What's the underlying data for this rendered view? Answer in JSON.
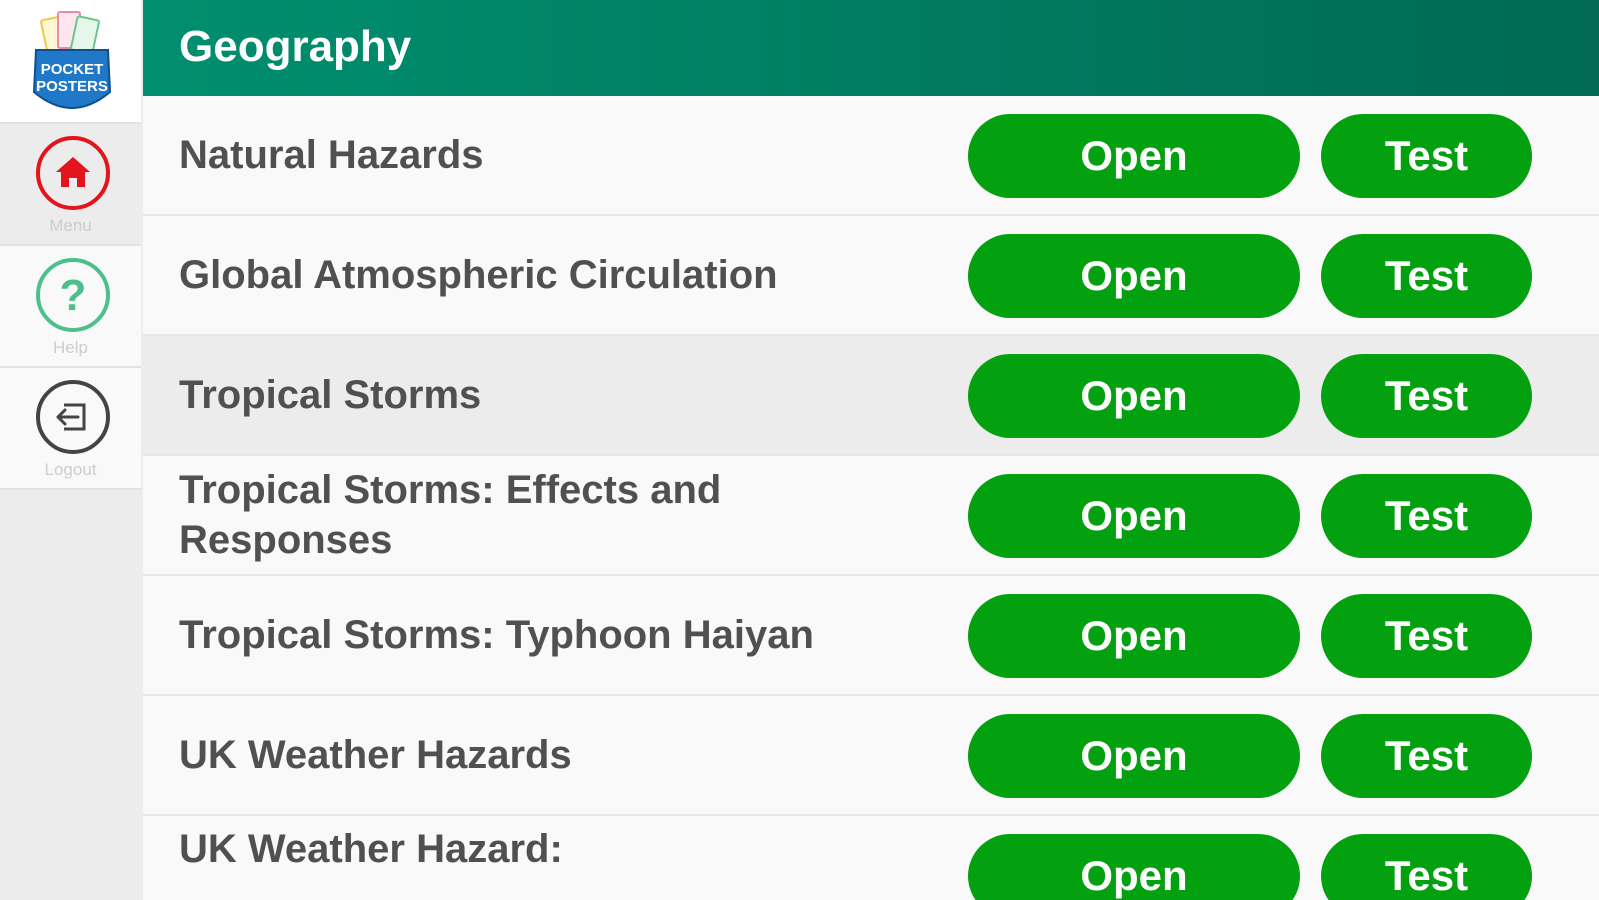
{
  "sidebar": {
    "logo_text": [
      "POCKET",
      "POSTERS"
    ],
    "items": [
      {
        "label": "Menu",
        "icon": "home-icon",
        "color": "#e3141b"
      },
      {
        "label": "Help",
        "icon": "question-icon",
        "color": "#4cc08a"
      },
      {
        "label": "Logout",
        "icon": "logout-icon",
        "color": "#444444"
      }
    ]
  },
  "header": {
    "title": "Geography",
    "color": "#00795f"
  },
  "rows": [
    {
      "topic": "Natural Hazards",
      "open_label": "Open",
      "test_label": "Test"
    },
    {
      "topic": "Global Atmospheric Circulation",
      "open_label": "Open",
      "test_label": "Test"
    },
    {
      "topic": "Tropical Storms",
      "open_label": "Open",
      "test_label": "Test"
    },
    {
      "topic": "Tropical Storms: Effects and Responses",
      "open_label": "Open",
      "test_label": "Test"
    },
    {
      "topic": "Tropical Storms: Typhoon Haiyan",
      "open_label": "Open",
      "test_label": "Test"
    },
    {
      "topic": "UK Weather Hazards",
      "open_label": "Open",
      "test_label": "Test"
    },
    {
      "topic": "UK Weather Hazard:",
      "open_label": "Open",
      "test_label": "Test"
    }
  ],
  "colors": {
    "button_green": "#03a00f",
    "text": "#505050"
  }
}
